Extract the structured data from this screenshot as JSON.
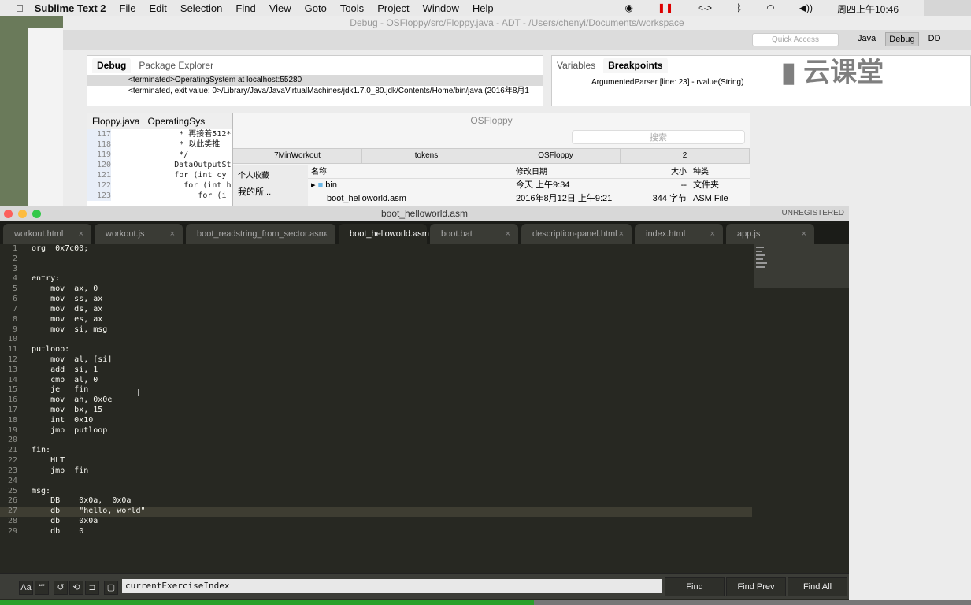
{
  "menubar": {
    "app": "Sublime Text 2",
    "items": [
      "File",
      "Edit",
      "Selection",
      "Find",
      "View",
      "Goto",
      "Tools",
      "Project",
      "Window",
      "Help"
    ],
    "clock": "周四上午10:46"
  },
  "eclipse": {
    "title": "Debug - OSFloppy/src/Floppy.java - ADT - /Users/chenyi/Documents/workspace",
    "quick_access": "Quick Access",
    "perspectives": [
      "Java",
      "Debug",
      "DD"
    ],
    "debug_tab": "Debug",
    "pkg_tab": "Package Explorer",
    "debug_rows": [
      "<terminated>OperatingSystem at localhost:55280",
      "<terminated, exit value: 0>/Library/Java/JavaVirtualMachines/jdk1.7.0_80.jdk/Contents/Home/bin/java (2016年8月1"
    ],
    "variables_tab": "Variables",
    "breakpoints_tab": "Breakpoints",
    "breakpoint": "ArgumentedParser [line: 23] - rvalue(String)",
    "java_tabs": [
      "Floppy.java",
      "OperatingSys"
    ],
    "java_lines": [
      {
        "n": "117",
        "t": "             * 再接着512*"
      },
      {
        "n": "118",
        "t": "             * 以此类推"
      },
      {
        "n": "119",
        "t": "             */"
      },
      {
        "n": "120",
        "t": "            DataOutputSt"
      },
      {
        "n": "121",
        "t": "            for (int cy"
      },
      {
        "n": "122",
        "t": "              for (int h"
      },
      {
        "n": "123",
        "t": "                 for (i"
      }
    ]
  },
  "watermark": "云课堂",
  "finder": {
    "title": "OSFloppy",
    "search": "搜索",
    "tabs": [
      "7MinWorkout",
      "tokens",
      "OSFloppy",
      "2"
    ],
    "sidebar_head": "个人收藏",
    "sidebar_item": "我的所...",
    "columns": [
      "名称",
      "修改日期",
      "大小",
      "种类"
    ],
    "rows": [
      {
        "name": "bin",
        "date": "今天 上午9:34",
        "size": "--",
        "kind": "文件夹"
      },
      {
        "name": "boot_helloworld.asm",
        "date": "2016年8月12日 上午9:21",
        "size": "344 字节",
        "kind": "ASM File"
      }
    ]
  },
  "sublime": {
    "title": "boot_helloworld.asm",
    "unregistered": "UNREGISTERED",
    "tabs": [
      "workout.html",
      "workout.js",
      "boot_readstring_from_sector.asm",
      "boot_helloworld.asm",
      "boot.bat",
      "description-panel.html",
      "index.html",
      "app.js"
    ],
    "active_tab": 3,
    "current_line": 27,
    "lines": [
      "org  0x7c00;",
      "",
      "",
      "entry:",
      "    mov  ax, 0",
      "    mov  ss, ax",
      "    mov  ds, ax",
      "    mov  es, ax",
      "    mov  si, msg",
      "",
      "putloop:",
      "    mov  al, [si]",
      "    add  si, 1",
      "    cmp  al, 0",
      "    je   fin",
      "    mov  ah, 0x0e",
      "    mov  bx, 15",
      "    int  0x10",
      "    jmp  putloop",
      "",
      "fin:",
      "    HLT",
      "    jmp  fin",
      "",
      "msg:",
      "    DB    0x0a,  0x0a",
      "    db    \"hello, world\"",
      "    db    0x0a",
      "    db    0"
    ],
    "find": {
      "value": "currentExerciseIndex",
      "case_label": "Aa",
      "word_label": "“”",
      "find": "Find",
      "find_prev": "Find Prev",
      "find_all": "Find All"
    }
  },
  "progress": 0.55
}
